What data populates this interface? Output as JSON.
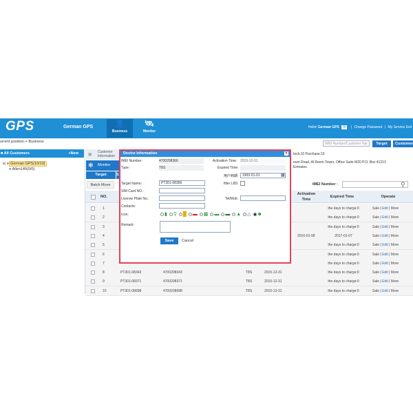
{
  "header": {
    "logo": "GPS",
    "brand": "German GPS",
    "nav": [
      {
        "label": "Business"
      },
      {
        "label": "Monitor"
      }
    ],
    "hello": "Hello!",
    "user": "German GPS",
    "change_password": "Change Password",
    "my_service": "My Service",
    "exit": "Exit"
  },
  "breadcrumb": "urrent position-> Business",
  "top_search": {
    "placeholder": "IMEI Number/Customer Nar",
    "target_label": "Target",
    "customer_label": "Customer"
  },
  "left": {
    "title": "All Customers",
    "new_label": "+New",
    "tree_root": "German GPS(10/10)",
    "tree_child": "Allen145(0/0)"
  },
  "side_tabs": {
    "customer": "Customer Information",
    "monitor": "Monitor"
  },
  "tabs": {
    "target": "Target",
    "second": "S"
  },
  "batch_move": "Batch Move",
  "customer_info": {
    "line1": "tock:10 Purchase:10",
    "line2": "eum Road, Al Reem Tower, Office Suite M20 P.O. Box 41213",
    "line3": "Emirates"
  },
  "imei_filter": {
    "label": "IMEI Number :"
  },
  "table": {
    "headers": {
      "no": "NO.",
      "activation": "Activation Time",
      "expired": "Expired Time",
      "operate": "Operate"
    },
    "rows": [
      {
        "no": "1",
        "name": "",
        "imei": "",
        "type": "",
        "activation": "",
        "act_time": "",
        "expired": "the days to charge:0"
      },
      {
        "no": "2",
        "name": "",
        "imei": "",
        "type": "",
        "activation": "",
        "act_time": "",
        "expired": "the days to charge:0"
      },
      {
        "no": "3",
        "name": "",
        "imei": "",
        "type": "",
        "activation": "",
        "act_time": "",
        "expired": "the days to charge:0"
      },
      {
        "no": "4",
        "name": "",
        "imei": "",
        "type": "",
        "activation": "",
        "act_time": "2016-01-08",
        "expired": "2017-01-07"
      },
      {
        "no": "5",
        "name": "",
        "imei": "",
        "type": "",
        "activation": "",
        "act_time": "",
        "expired": "the days to charge:0"
      },
      {
        "no": "6",
        "name": "",
        "imei": "",
        "type": "",
        "activation": "",
        "act_time": "",
        "expired": "the days to charge:0"
      },
      {
        "no": "7",
        "name": "",
        "imei": "",
        "type": "",
        "activation": "",
        "act_time": "",
        "expired": "the days to charge:0"
      },
      {
        "no": "8",
        "name": "PT301-08343",
        "imei": "4700208343",
        "type": "T8S",
        "activation": "2015-12-31",
        "act_time": "",
        "expired": "the days to charge:0"
      },
      {
        "no": "9",
        "name": "PT301-08371",
        "imei": "4700208371",
        "type": "T8S",
        "activation": "2015-12-31",
        "act_time": "",
        "expired": "the days to charge:0"
      },
      {
        "no": "10",
        "name": "PT301-08698",
        "imei": "4700208698",
        "type": "T8S",
        "activation": "2015-12-31",
        "act_time": "",
        "expired": "the days to charge:0"
      }
    ],
    "ops": {
      "sale": "Sale",
      "edit": "Edit",
      "more": "More"
    }
  },
  "dialog": {
    "title": "Device Information",
    "close": "×",
    "imei_label": "IMEI Number:",
    "imei_value": "4700208366",
    "activation_label": "Activation Time:",
    "activation_value": "2015-12-31",
    "type_label": "Type:",
    "type_value": "T8S",
    "expired_label": "Expired Time:",
    "user_expiry_label": "用户到期",
    "user_expiry_value": "1900-01-01",
    "target_name_label": "Target Name:",
    "target_name_value": "PT301-08366",
    "filter_lbs_label": "filter LBS",
    "sim_label": "SIM Card NO.:",
    "plate_label": "License Plate No.:",
    "telmob_label": "Tel/Mob:",
    "contacts_label": "Contacts:",
    "icon_label": "Icon:",
    "remark_label": "Remark:",
    "save_label": "Save",
    "cancel_label": "Cancel"
  }
}
